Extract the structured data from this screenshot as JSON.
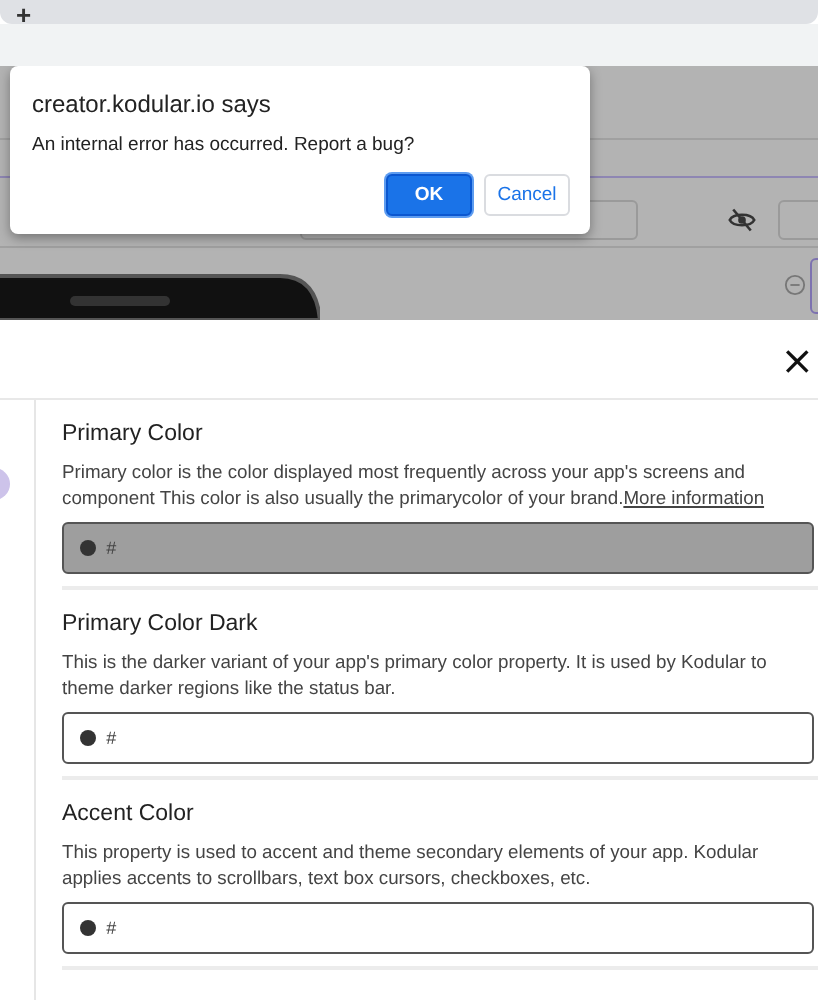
{
  "browser": {
    "new_tab_icon": "+"
  },
  "dialog": {
    "title": "creator.kodular.io says",
    "message": "An internal error has occurred. Report a bug?",
    "buttons": [
      {
        "label": "OK",
        "kind": "primary"
      },
      {
        "label": "Cancel",
        "kind": "secondary"
      }
    ]
  },
  "panel": {
    "close": "×",
    "sections": [
      {
        "title": "Primary Color",
        "description": "Primary color is the color displayed most frequently across your app's screens and component This color is also usually the primarycolor of your brand.",
        "link": "More information",
        "field": {
          "value": "#",
          "disabled": true
        }
      },
      {
        "title": "Primary Color Dark",
        "description": "This is the darker variant of your app's primary color property. It is used by Kodular to theme darker regions like the status bar.",
        "field": {
          "value": "#",
          "disabled": false
        }
      },
      {
        "title": "Accent Color",
        "description": "This property is used to accent and theme secondary elements of your app. Kodular applies accents to scrollbars, text box cursors, checkboxes, etc.",
        "field": {
          "value": "#",
          "disabled": false
        }
      }
    ]
  }
}
